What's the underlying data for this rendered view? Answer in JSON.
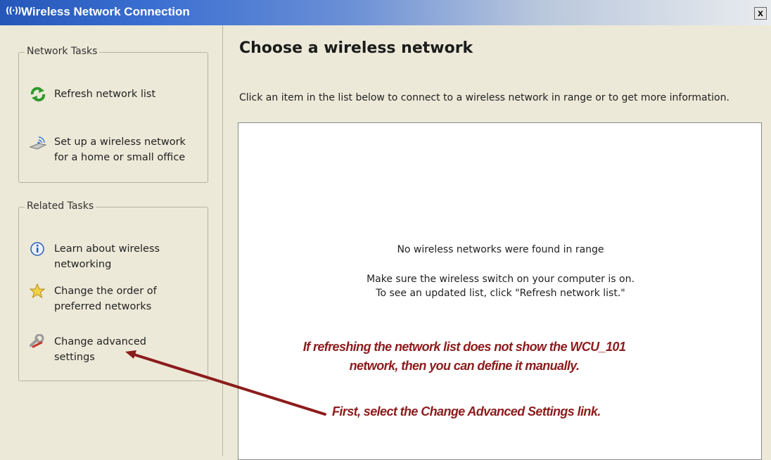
{
  "window": {
    "title": "Wireless Network Connection",
    "close_label": "x",
    "icon_glyph": "((·))"
  },
  "sidebar": {
    "network_tasks": {
      "legend": "Network Tasks",
      "items": [
        {
          "label": "Refresh network list",
          "icon": "refresh-icon"
        },
        {
          "label": "Set up a wireless network\nfor a home or small office",
          "icon": "wireless-setup-icon"
        }
      ]
    },
    "related_tasks": {
      "legend": "Related Tasks",
      "items": [
        {
          "label": "Learn about wireless\nnetworking",
          "icon": "info-icon"
        },
        {
          "label": "Change the order of\npreferred networks",
          "icon": "star-icon"
        },
        {
          "label": "Change advanced\nsettings",
          "icon": "settings-icon"
        }
      ]
    }
  },
  "main": {
    "heading": "Choose a wireless network",
    "instructions": "Click an item in the list below to connect to a wireless network in range or to get more information.",
    "list": {
      "empty_title": "No wireless networks were found in range",
      "empty_line1": "Make sure the wireless switch on your computer is on.",
      "empty_line2": "To see an updated list, click \"Refresh network list.\""
    }
  },
  "annotations": {
    "note_line1": "If refreshing the network list does not show the WCU_101",
    "note_line2": "network, then you can define it manually.",
    "step": "First, select the Change Advanced Settings link.",
    "color": "#8c1c1c"
  }
}
